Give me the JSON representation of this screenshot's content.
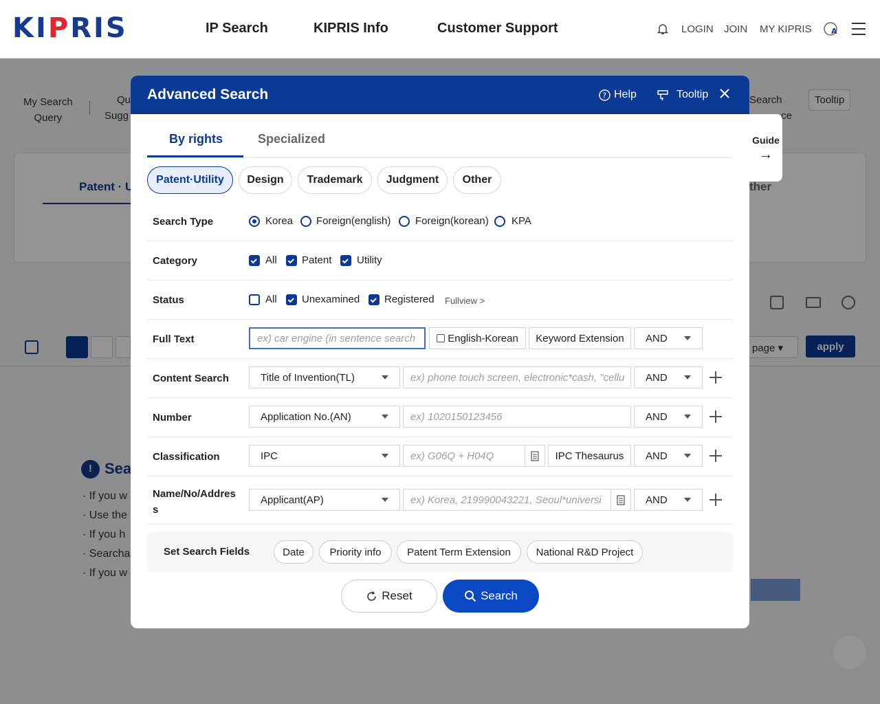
{
  "header": {
    "logo": "KIPRIS",
    "nav": [
      "IP Search",
      "KIPRIS Info",
      "Customer Support"
    ],
    "links": [
      "LOGIN",
      "JOIN",
      "MY KIPRIS"
    ]
  },
  "background": {
    "my_search_query": "My Search\nQuery",
    "qu": "Qu",
    "sugg": "Sugg",
    "search": "Search",
    "ce": "ce",
    "tooltip": "Tooltip",
    "patent_tab": "Patent · U",
    "ther": "ther",
    "page": "page",
    "apply": "apply",
    "sea": "Sea",
    "bullets": [
      "If you w",
      "Use the",
      "If you h",
      "Searcha",
      "If you w"
    ]
  },
  "guide": {
    "label": "Guide",
    "arrow": "→"
  },
  "modal": {
    "title": "Advanced Search",
    "help": "Help",
    "tooltip": "Tooltip",
    "tabs": [
      "By rights",
      "Specialized"
    ],
    "chips": [
      "Patent·Utility",
      "Design",
      "Trademark",
      "Judgment",
      "Other"
    ],
    "search_type": {
      "label": "Search Type",
      "options": [
        "Korea",
        "Foreign(english)",
        "Foreign(korean)",
        "KPA"
      ],
      "selected": "Korea"
    },
    "category": {
      "label": "Category",
      "options": [
        "All",
        "Patent",
        "Utility"
      ]
    },
    "status": {
      "label": "Status",
      "options": [
        "All",
        "Unexamined",
        "Registered"
      ],
      "fullview": "Fullview >"
    },
    "full_text": {
      "label": "Full Text",
      "placeholder": "ex) car engine (in sentence search",
      "english_korean": "English-Korean",
      "keyword_extension": "Keyword Extension",
      "operator": "AND"
    },
    "content_search": {
      "label": "Content Search",
      "field": "Title of Invention(TL)",
      "placeholder": "ex) phone touch screen, electronic*cash, \"cellu",
      "operator": "AND"
    },
    "number": {
      "label": "Number",
      "field": "Application No.(AN)",
      "placeholder": "ex) 1020150123456",
      "operator": "AND"
    },
    "classification": {
      "label": "Classification",
      "field": "IPC",
      "placeholder": "ex) G06Q + H04Q",
      "thesaurus": "IPC Thesaurus",
      "operator": "AND"
    },
    "name": {
      "label_1": "Name/No/Addres",
      "label_2": "s",
      "field": "Applicant(AP)",
      "placeholder": "ex) Korea, 219990043221, Seoul*universi",
      "operator": "AND"
    },
    "set_fields": {
      "label": "Set Search Fields",
      "pills": [
        "Date",
        "Priority info",
        "Patent Term Extension",
        "National R&D Project"
      ]
    },
    "reset": "Reset",
    "search": "Search"
  },
  "colors": {
    "primary": "#0a3a94",
    "accent_red": "#e2262f"
  }
}
